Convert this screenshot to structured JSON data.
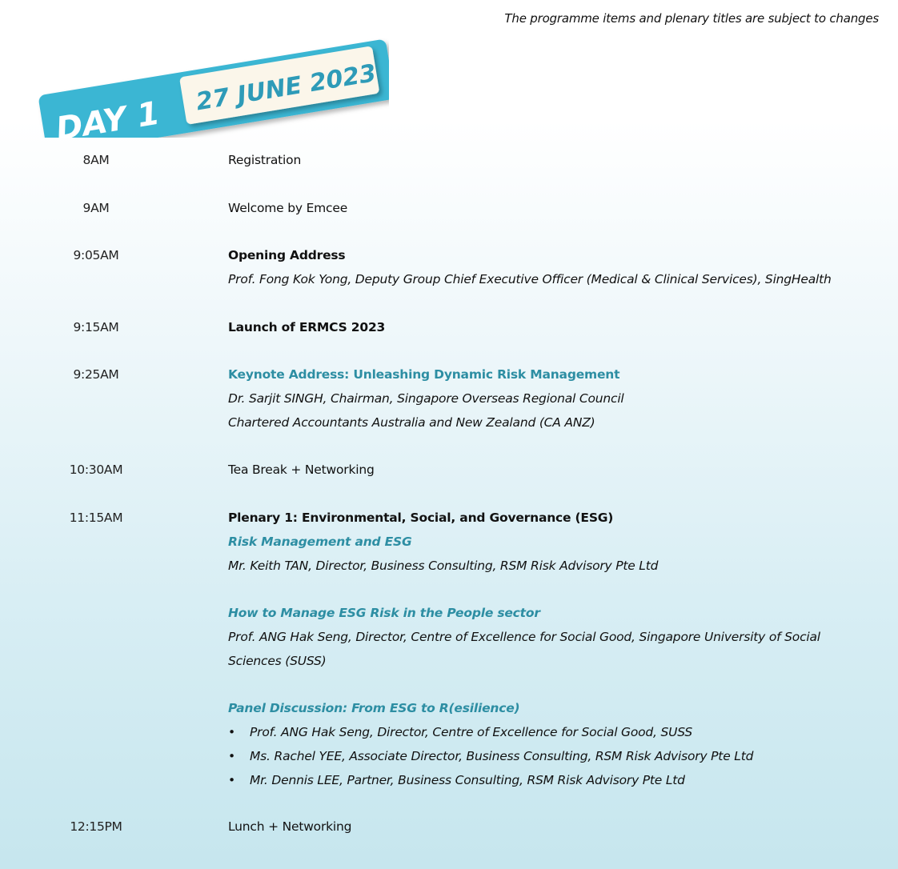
{
  "disclaimer": "The programme items and plenary titles are subject to changes",
  "banner": {
    "day": "DAY 1",
    "date": "27 JUNE 2023"
  },
  "schedule": {
    "r0": {
      "time": "8AM",
      "title": "Registration"
    },
    "r1": {
      "time": "9AM",
      "title": "Welcome by Emcee"
    },
    "r2": {
      "time": "9:05AM",
      "title": "Opening Address",
      "speaker": "Prof. Fong Kok Yong, Deputy Group Chief Executive Officer (Medical & Clinical Services), SingHealth"
    },
    "r3": {
      "time": "9:15AM",
      "title": "Launch of ERMCS 2023"
    },
    "r4": {
      "time": "9:25AM",
      "title": "Keynote Address: Unleashing Dynamic Risk Management",
      "speaker1": "Dr. Sarjit SINGH, Chairman, Singapore Overseas Regional Council",
      "speaker2": "Chartered Accountants Australia and New Zealand (CA ANZ)"
    },
    "r5": {
      "time": "10:30AM",
      "title": "Tea Break + Networking"
    },
    "r6": {
      "time": "11:15AM",
      "title": "Plenary 1:  Environmental, Social, and Governance (ESG)",
      "s1_title": "Risk Management and ESG",
      "s1_speaker": "Mr. Keith TAN, Director, Business Consulting, RSM Risk Advisory Pte Ltd",
      "s2_title": "How to Manage ESG Risk in the People sector",
      "s2_speaker": "Prof. ANG Hak Seng, Director, Centre of Excellence for Social Good, Singapore University of Social Sciences (SUSS)",
      "s3_title": "Panel Discussion: From ESG to R(esilience)",
      "bullet": "•",
      "panelists": [
        "Prof. ANG Hak Seng, Director, Centre of Excellence for Social Good, SUSS",
        "Ms. Rachel YEE, Associate Director, Business Consulting, RSM Risk Advisory Pte Ltd",
        "Mr. Dennis LEE, Partner, Business Consulting, RSM Risk Advisory Pte Ltd"
      ]
    },
    "r7": {
      "time": "12:15PM",
      "title": "Lunch + Networking"
    }
  },
  "colors": {
    "accent": "#2d8ea3",
    "banner_bg": "#3bb6d3",
    "date_box": "#fbf6ea",
    "date_text": "#2e9bb8"
  }
}
